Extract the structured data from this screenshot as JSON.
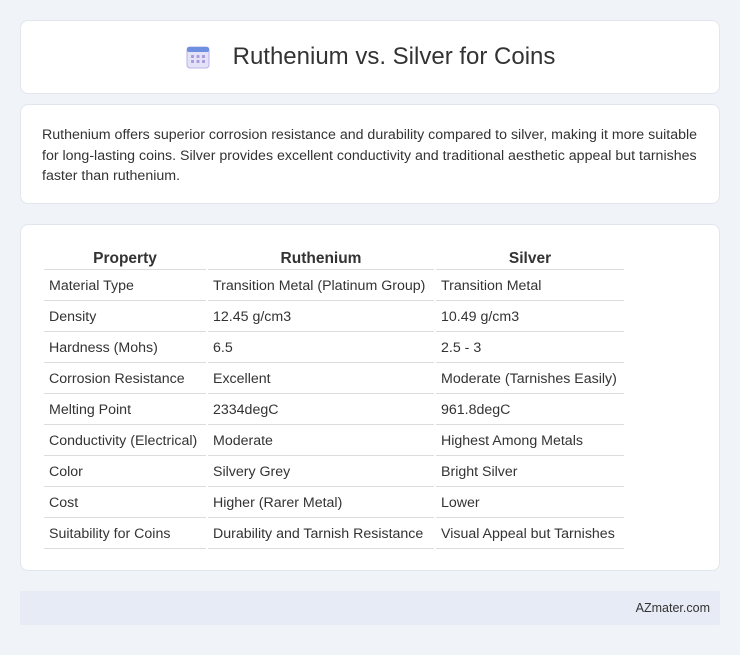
{
  "header": {
    "title": "Ruthenium vs. Silver for Coins",
    "icon": "calendar-icon"
  },
  "summary": {
    "text": "Ruthenium offers superior corrosion resistance and durability compared to silver, making it more suitable for long-lasting coins. Silver provides excellent conductivity and traditional aesthetic appeal but tarnishes faster than ruthenium."
  },
  "table": {
    "headers": [
      "Property",
      "Ruthenium",
      "Silver"
    ],
    "rows": [
      [
        "Material Type",
        "Transition Metal (Platinum Group)",
        "Transition Metal"
      ],
      [
        "Density",
        "12.45 g/cm3",
        "10.49 g/cm3"
      ],
      [
        "Hardness (Mohs)",
        "6.5",
        "2.5 - 3"
      ],
      [
        "Corrosion Resistance",
        "Excellent",
        "Moderate (Tarnishes Easily)"
      ],
      [
        "Melting Point",
        "2334degC",
        "961.8degC"
      ],
      [
        "Conductivity (Electrical)",
        "Moderate",
        "Highest Among Metals"
      ],
      [
        "Color",
        "Silvery Grey",
        "Bright Silver"
      ],
      [
        "Cost",
        "Higher (Rarer Metal)",
        "Lower"
      ],
      [
        "Suitability for Coins",
        "Durability and Tarnish Resistance",
        "Visual Appeal but Tarnishes"
      ]
    ]
  },
  "footer": {
    "text": "AZmater.com"
  }
}
